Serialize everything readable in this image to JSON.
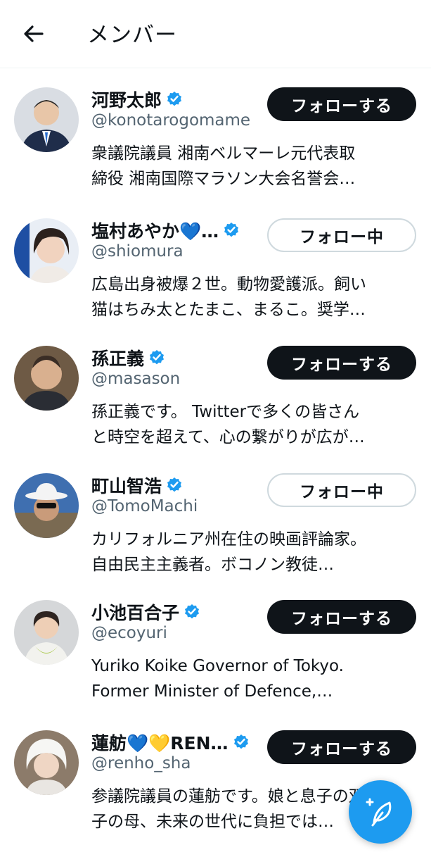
{
  "header": {
    "title": "メンバー"
  },
  "users": [
    {
      "name": "河野太郎",
      "handle": "@konotarogomame",
      "bio1": "衆議院議員 湘南ベルマーレ元代表取",
      "bio2": "締役 湘南国際マラソン大会名誉会…",
      "button": "フォローする",
      "state": "follow"
    },
    {
      "name": "塩村あやか💙…",
      "handle": "@shiomura",
      "bio1": "広島出身被爆２世。動物愛護派。飼い",
      "bio2": "猫はちみ太とたまこ、まるこ。奨学…",
      "button": "フォロー中",
      "state": "following"
    },
    {
      "name": "孫正義",
      "handle": "@masason",
      "bio1": "孫正義です。 Twitterで多くの皆さん",
      "bio2": "と時空を超えて、心の繋がりが広が…",
      "button": "フォローする",
      "state": "follow"
    },
    {
      "name": "町山智浩",
      "handle": "@TomoMachi",
      "bio1": "カリフォルニア州在住の映画評論家。",
      "bio2": "自由民主主義者。ボコノン教徒…",
      "button": "フォロー中",
      "state": "following"
    },
    {
      "name": "小池百合子",
      "handle": "@ecoyuri",
      "bio1": "Yuriko Koike Governor of Tokyo.",
      "bio2": "Former Minister of Defence,…",
      "button": "フォローする",
      "state": "follow"
    },
    {
      "name": "蓮舫💙💛REN…",
      "handle": "@renho_sha",
      "bio1": "参議院議員の蓮舫です。娘と息子の双",
      "bio2": "子の母、未来の世代に負担では…",
      "button": "フォローする",
      "state": "follow"
    }
  ],
  "icons": {
    "back": "arrow-left-icon",
    "verified": "verified-badge-icon",
    "compose": "compose-feather-icon"
  },
  "colors": {
    "accent": "#1d9bf0",
    "text": "#0f1419",
    "secondary": "#536471"
  }
}
